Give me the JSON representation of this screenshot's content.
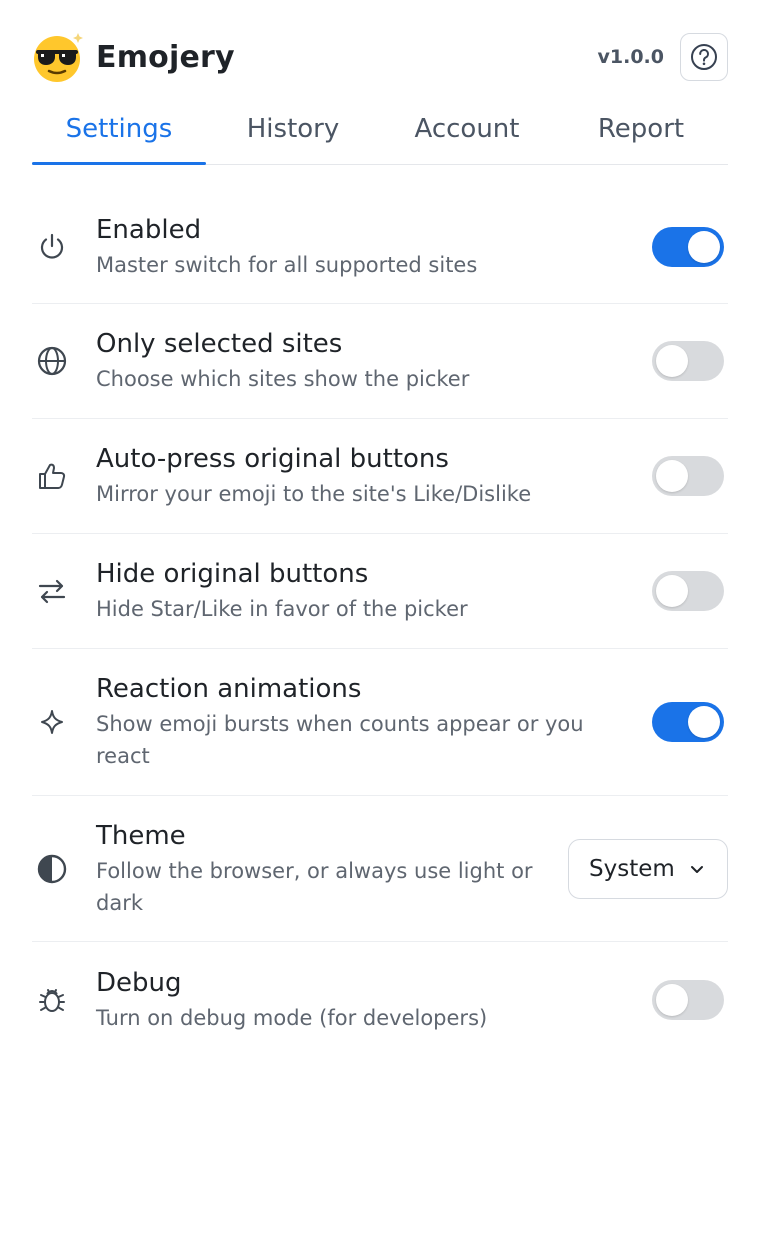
{
  "app": {
    "name": "Emojery",
    "version": "v1.0.0"
  },
  "icons": {
    "logo": "sunglasses-emoji-icon",
    "help": "question-circle-icon"
  },
  "colors": {
    "accent": "#1a73e8",
    "toggle_off": "#d8dadd"
  },
  "tabs": [
    {
      "label": "Settings",
      "active": true
    },
    {
      "label": "History",
      "active": false
    },
    {
      "label": "Account",
      "active": false
    },
    {
      "label": "Report",
      "active": false
    }
  ],
  "settings": [
    {
      "icon": "power-icon",
      "title": "Enabled",
      "description": "Master switch for all supported sites",
      "control": "toggle",
      "on": true
    },
    {
      "icon": "globe-icon",
      "title": "Only selected sites",
      "description": "Choose which sites show the picker",
      "control": "toggle",
      "on": false
    },
    {
      "icon": "thumbs-up-icon",
      "title": "Auto-press original buttons",
      "description": "Mirror your emoji to the site's Like/Dislike",
      "control": "toggle",
      "on": false
    },
    {
      "icon": "swap-arrows-icon",
      "title": "Hide original buttons",
      "description": "Hide Star/Like in favor of the picker",
      "control": "toggle",
      "on": false
    },
    {
      "icon": "sparkle-icon",
      "title": "Reaction animations",
      "description": "Show emoji bursts when counts appear or you react",
      "control": "toggle",
      "on": true
    },
    {
      "icon": "contrast-icon",
      "title": "Theme",
      "description": "Follow the browser, or always use light or dark",
      "control": "select",
      "value": "System"
    },
    {
      "icon": "bug-icon",
      "title": "Debug",
      "description": "Turn on debug mode (for developers)",
      "control": "toggle",
      "on": false
    }
  ]
}
